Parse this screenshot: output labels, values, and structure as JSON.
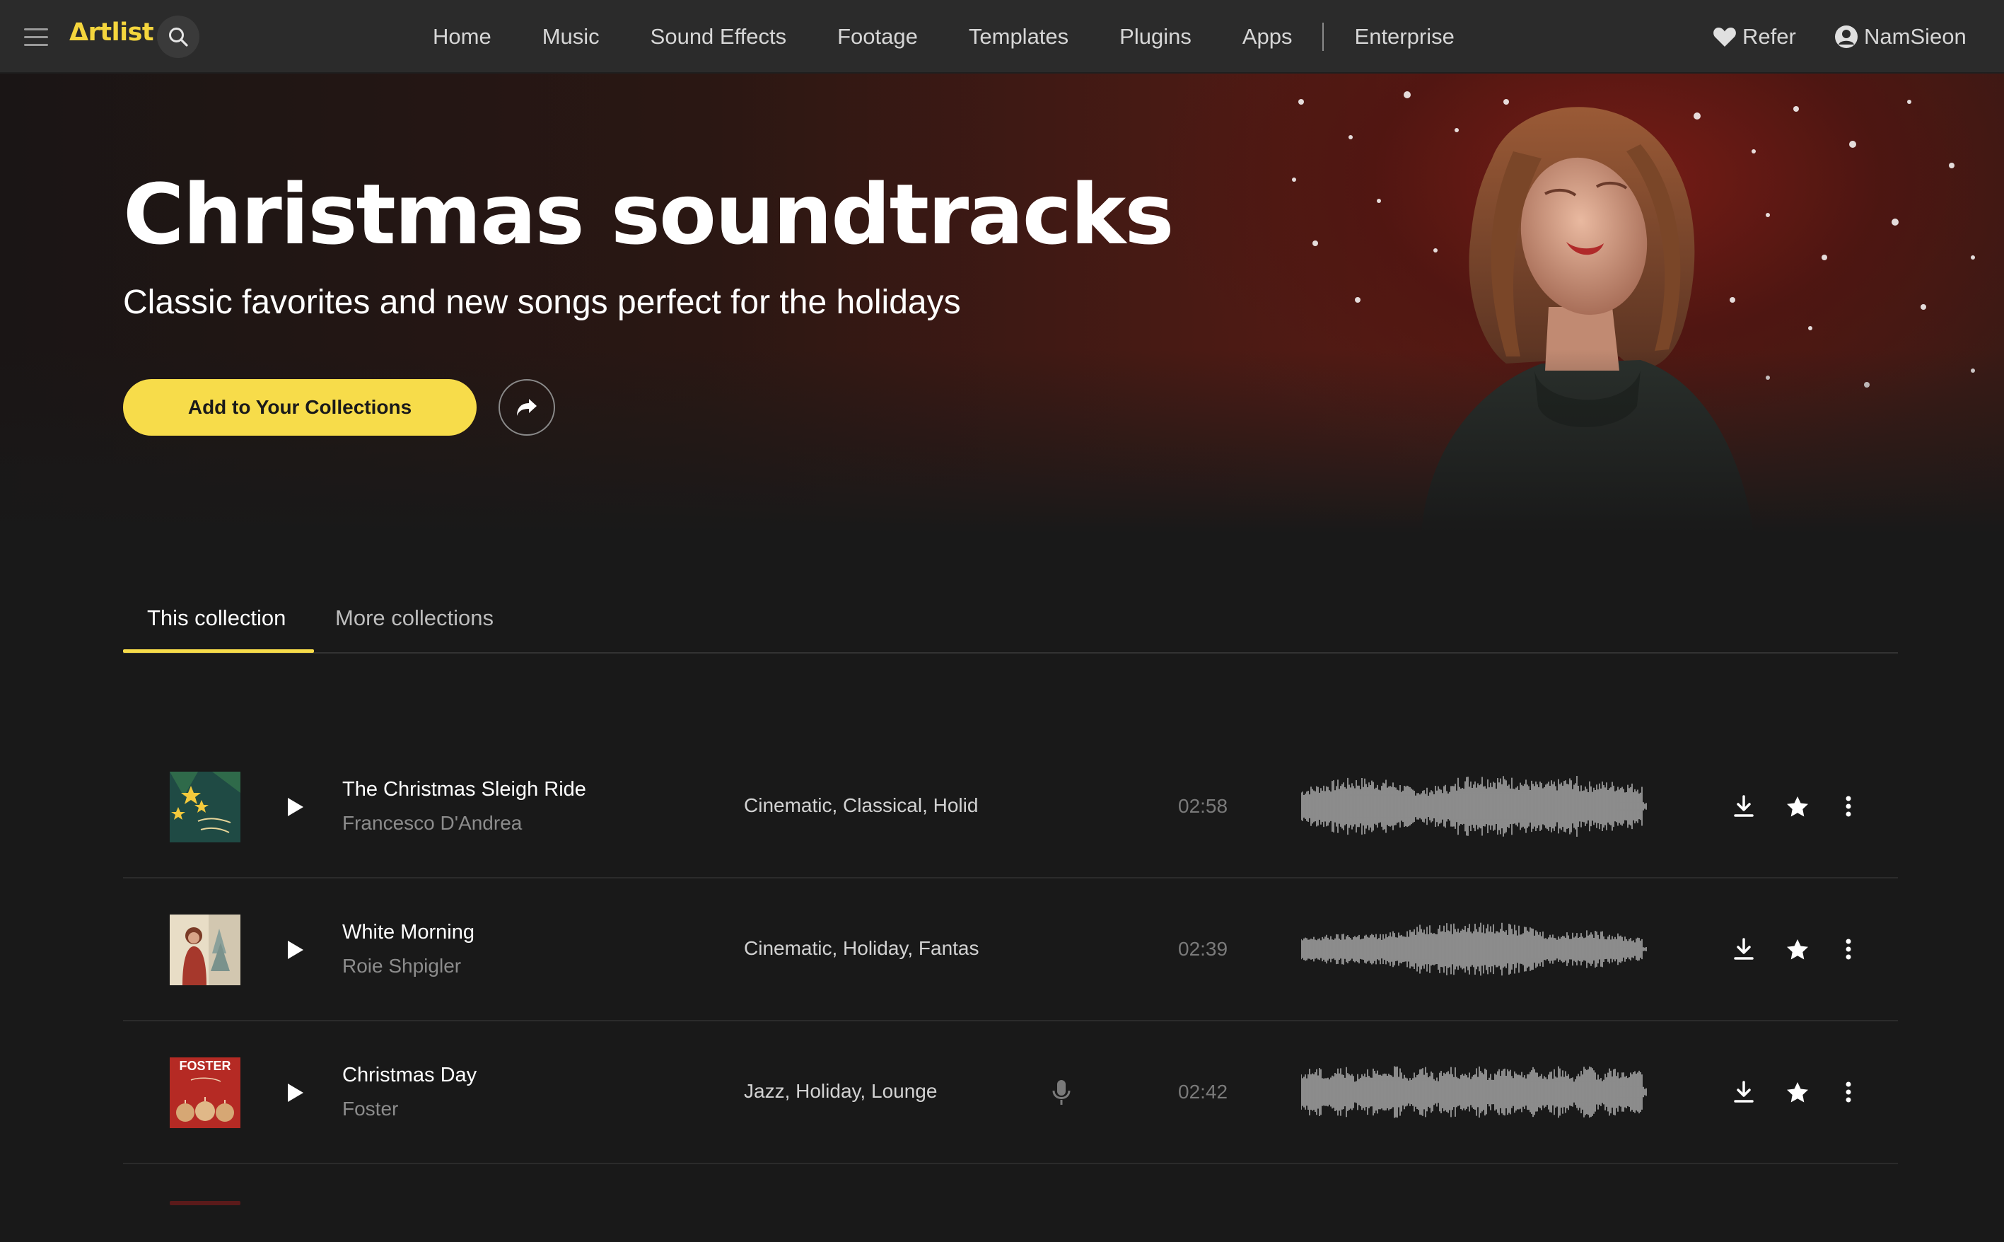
{
  "brand": {
    "logo_text": "Δrtlist",
    "accent": "#f7dc4a"
  },
  "nav": {
    "items": [
      "Home",
      "Music",
      "Sound Effects",
      "Footage",
      "Templates",
      "Plugins",
      "Apps"
    ],
    "enterprise": "Enterprise",
    "refer": "Refer",
    "user": "NamSieon"
  },
  "hero": {
    "title": "Christmas soundtracks",
    "subtitle": "Classic favorites and new songs perfect for the holidays",
    "add_button": "Add to Your Collections"
  },
  "tabs": {
    "active": "This collection",
    "other": "More collections"
  },
  "tracks": [
    {
      "title": "The Christmas Sleigh Ride",
      "artist": "Francesco D'Andrea",
      "tags": "Cinematic, Classical, Holid",
      "duration": "02:58",
      "vocal": false
    },
    {
      "title": "White Morning",
      "artist": "Roie Shpigler",
      "tags": "Cinematic, Holiday, Fantas",
      "duration": "02:39",
      "vocal": false
    },
    {
      "title": "Christmas Day",
      "artist": "Foster",
      "tags": "Jazz, Holiday, Lounge",
      "duration": "02:42",
      "vocal": true,
      "cover_text": "FOSTER"
    }
  ]
}
